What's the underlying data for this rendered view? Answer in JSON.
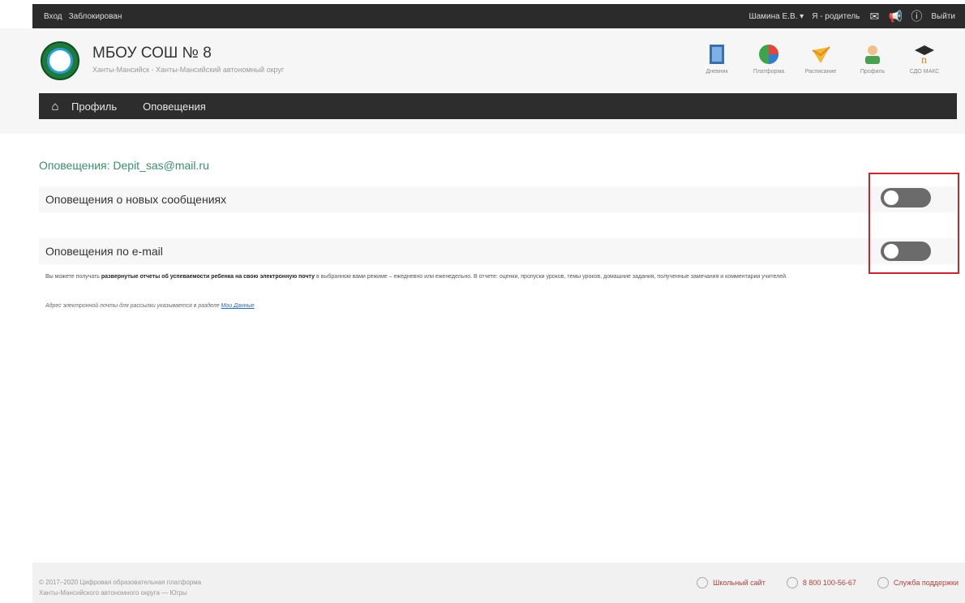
{
  "topbar": {
    "left_items": [
      "Вход",
      "Заблокирован"
    ],
    "user": "Шамина Е.В. ▾",
    "role": "Я - родитель",
    "logout": "Выйти"
  },
  "header": {
    "school_name": "МБОУ СОШ № 8",
    "school_sub": "Ханты-Мансийск - Ханты-Мансийский автономный округ",
    "apps": [
      {
        "label": "Дневник",
        "icon": "diary-icon"
      },
      {
        "label": "Платформа",
        "icon": "platform-icon"
      },
      {
        "label": "Расписание",
        "icon": "schedule-icon"
      },
      {
        "label": "Профиль",
        "icon": "profile-icon"
      },
      {
        "label": "СДО МАКС",
        "icon": "sdo-icon"
      }
    ]
  },
  "nav": {
    "items": [
      "Профиль",
      "Оповещения"
    ]
  },
  "content": {
    "title": "Оповещения: Depit_sas@mail.ru",
    "row1": "Оповещения о новых сообщениях",
    "row2": "Оповещения по e-mail",
    "desc_pre": "Вы можете получать ",
    "desc_bold": "развернутые отчеты об успеваемости ребенка на свою электронную почту",
    "desc_post": " в выбранном вами режиме – ежедневно или еженедельно. В отчете: оценки, пропуски уроков, темы уроков, домашние задания, полученные замечания и комментарии учителей.",
    "desc2_text": "Адрес электронной почты для рассылки указывается в разделе ",
    "desc2_link": "Мои Данные",
    "toggle1_on": false,
    "toggle2_on": false
  },
  "footer": {
    "line1": "© 2017–2020 Цифровая образовательная платформа",
    "line2": "Ханты-Мансийского автономного округа — Югры",
    "links": [
      {
        "label": "Школьный сайт"
      },
      {
        "label": "8 800 100-56-67"
      },
      {
        "label": "Служба поддержки"
      }
    ]
  },
  "colors": {
    "accent": "#3a8f6b",
    "toggle_off": "#6b6b6b",
    "highlight": "#c9252e"
  }
}
